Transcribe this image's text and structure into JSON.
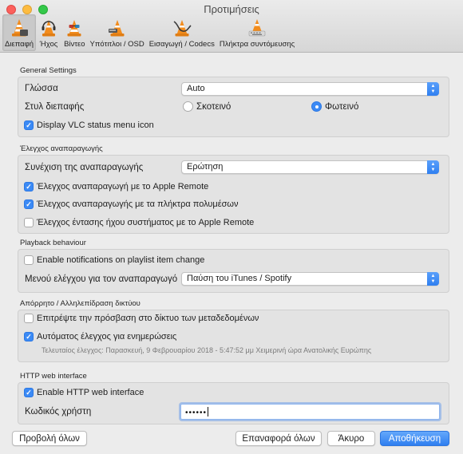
{
  "window": {
    "title": "Προτιμήσεις"
  },
  "tabs": [
    {
      "label": "Διεπαφή",
      "icon": "vlc-cone-icon",
      "active": true
    },
    {
      "label": "Ήχος",
      "icon": "vlc-cone-headphones-icon",
      "active": false
    },
    {
      "label": "Βίντεο",
      "icon": "vlc-cone-glasses-icon",
      "active": false
    },
    {
      "label": "Υπότιτλοι / OSD",
      "icon": "vlc-cone-subtitles-icon",
      "active": false
    },
    {
      "label": "Εισαγωγή / Codecs",
      "icon": "vlc-cone-cable-icon",
      "active": false
    },
    {
      "label": "Πλήκτρα συντόμευσης",
      "icon": "vlc-cone-keyboard-icon",
      "active": false
    }
  ],
  "general": {
    "title": "General Settings",
    "language_label": "Γλώσσα",
    "language_value": "Auto",
    "style_label": "Στυλ διεπαφής",
    "style_dark": "Σκοτεινό",
    "style_light": "Φωτεινό",
    "status_menu_label": "Display VLC status menu icon"
  },
  "playback_control": {
    "title": "Έλεγχος αναπαραγωγής",
    "continue_label": "Συνέχιση της αναπαραγωγής",
    "continue_value": "Ερώτηση",
    "apple_remote_label": "Έλεγχος αναπαραγωγή με το Apple Remote",
    "media_keys_label": "Έλεγχος αναπαραγωγής με τα πλήκτρα πολυμέσων",
    "volume_remote_label": "Έλεγχος έντασης ήχου συστήματος με το Apple Remote"
  },
  "behaviour": {
    "title": "Playback behaviour",
    "notifications_label": "Enable notifications on playlist item change",
    "pause_menu_label": "Μενού ελέγχου για τον αναπαραγωγό",
    "pause_menu_value": "Παύση του iTunes / Spotify"
  },
  "privacy": {
    "title": "Απόρρητο / Αλληλεπίδραση δικτύου",
    "metadata_label": "Επιτρέψτε την πρόσβαση στο δίκτυο των μεταδεδομένων",
    "updates_label": "Αυτόματος έλεγχος για ενημερώσεις",
    "last_check": "Τελευταίος έλεγχος: Παρασκευή, 9 Φεβρουαρίου 2018 - 5:47:52 μμ Χειμερινή ώρα Ανατολικής Ευρώπης"
  },
  "http": {
    "title": "HTTP web interface",
    "enable_label": "Enable HTTP web interface",
    "password_label": "Κωδικός χρήστη",
    "password_value": "••••••"
  },
  "buttons": {
    "show_all": "Προβολή όλων",
    "reset_all": "Επαναφορά όλων",
    "cancel": "Άκυρο",
    "save": "Αποθήκευση"
  },
  "colors": {
    "accent": "#3b8af5"
  }
}
